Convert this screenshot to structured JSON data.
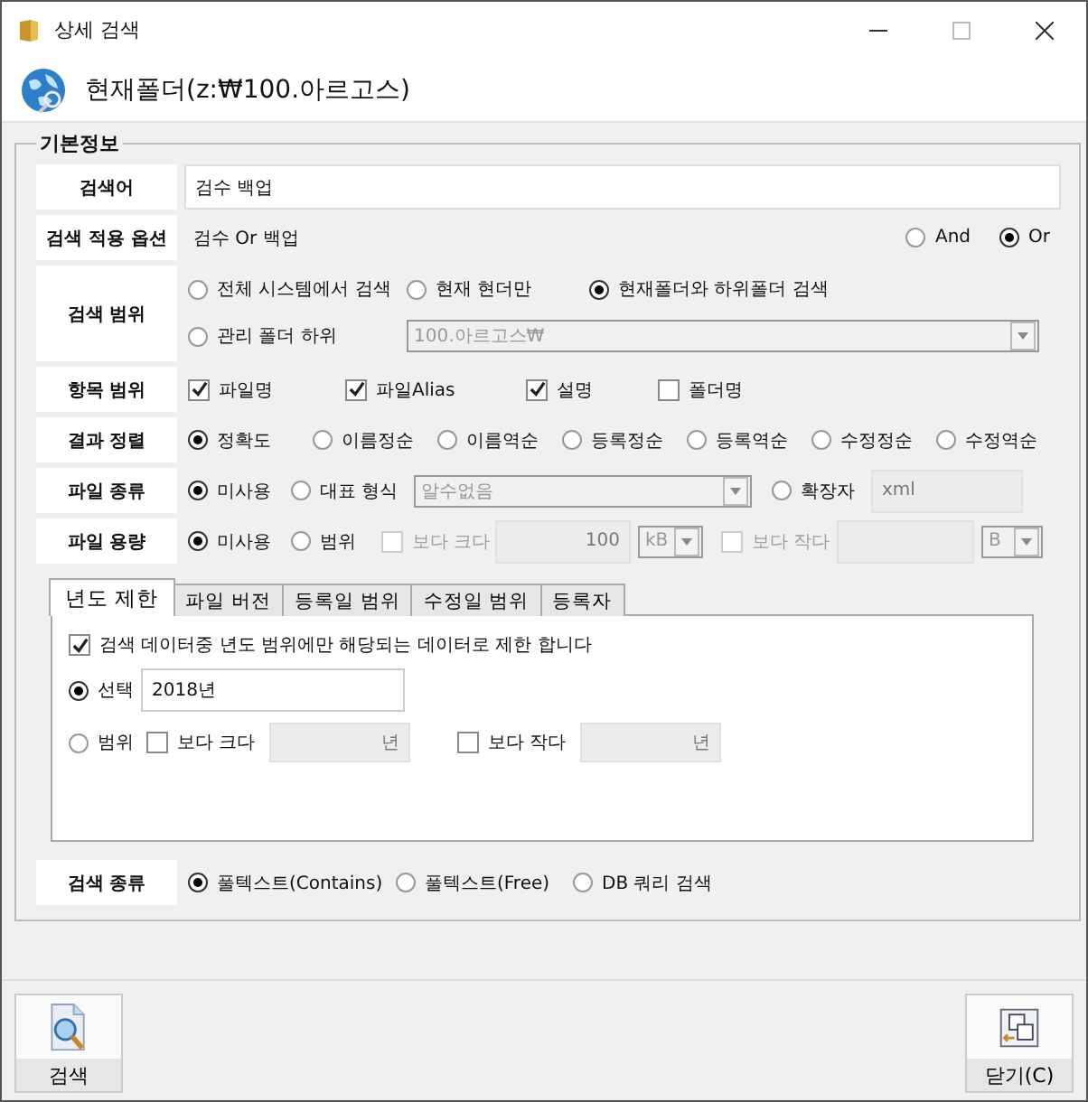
{
  "window": {
    "title": "상세 검색"
  },
  "header": {
    "title": "현재폴더(z:₩100.아르고스)"
  },
  "group": {
    "legend": "기본정보"
  },
  "rows": [
    {
      "kind": "input",
      "label": "검색어",
      "controls": [
        {
          "kind": "field",
          "value": "검수 백업"
        }
      ]
    },
    {
      "kind": "option",
      "label": "검색 적용 옵션",
      "controls": [
        {
          "kind": "text",
          "value": "검수 Or 백업"
        },
        {
          "kind": "radio",
          "label": "And",
          "selected": false
        },
        {
          "kind": "radio",
          "label": "Or",
          "selected": true
        }
      ]
    },
    {
      "kind": "scope",
      "label": "검색 범위",
      "controls": [
        {
          "kind": "radio",
          "label": "전체 시스템에서 검색",
          "selected": false
        },
        {
          "kind": "radio",
          "label": "현재 현더만",
          "selected": false
        },
        {
          "kind": "radio",
          "label": "현재폴더와 하위폴더 검색",
          "selected": true
        },
        {
          "kind": "radio",
          "label": "관리 폴더 하위",
          "selected": false
        },
        {
          "kind": "combo",
          "value": "100.아르고스₩",
          "disabled": true
        }
      ]
    },
    {
      "kind": "checks",
      "label": "항목 범위",
      "controls": [
        {
          "kind": "checkbox",
          "label": "파일명",
          "checked": true
        },
        {
          "kind": "checkbox",
          "label": "파일Alias",
          "checked": true
        },
        {
          "kind": "checkbox",
          "label": "설명",
          "checked": true
        },
        {
          "kind": "checkbox",
          "label": "폴더명",
          "checked": false
        }
      ]
    },
    {
      "kind": "sort",
      "label": "결과 정렬",
      "controls": [
        {
          "kind": "radio",
          "label": "정확도",
          "selected": true
        },
        {
          "kind": "radio",
          "label": "이름정순",
          "selected": false
        },
        {
          "kind": "radio",
          "label": "이름역순",
          "selected": false
        },
        {
          "kind": "radio",
          "label": "등록정순",
          "selected": false
        },
        {
          "kind": "radio",
          "label": "등록역순",
          "selected": false
        },
        {
          "kind": "radio",
          "label": "수정정순",
          "selected": false
        },
        {
          "kind": "radio",
          "label": "수정역순",
          "selected": false
        }
      ]
    },
    {
      "kind": "filetype",
      "label": "파일 종류",
      "controls": [
        {
          "kind": "radio",
          "label": "미사용",
          "selected": true
        },
        {
          "kind": "radio",
          "label": "대표 형식",
          "selected": false
        },
        {
          "kind": "combo",
          "value": "알수없음",
          "disabled": true
        },
        {
          "kind": "radio",
          "label": "확장자",
          "selected": false
        },
        {
          "kind": "field",
          "value": "xml",
          "disabled": true
        }
      ]
    },
    {
      "kind": "filesize",
      "label": "파일 용량",
      "controls": [
        {
          "kind": "radio",
          "label": "미사용",
          "selected": true
        },
        {
          "kind": "radio",
          "label": "범위",
          "selected": false
        },
        {
          "kind": "checkbox",
          "label": "보다 크다",
          "checked": false,
          "disabled": true
        },
        {
          "kind": "field",
          "value": "100",
          "disabled": true
        },
        {
          "kind": "combo",
          "value": "kB",
          "disabled": true
        },
        {
          "kind": "checkbox",
          "label": "보다 작다",
          "checked": false,
          "disabled": true
        },
        {
          "kind": "field",
          "disabled": true
        },
        {
          "kind": "combo",
          "value": "B",
          "disabled": true
        }
      ]
    }
  ],
  "tabs": [
    {
      "label": "년도 제한",
      "selected": true
    },
    {
      "label": "파일 버전",
      "selected": false
    },
    {
      "label": "등록일 범위",
      "selected": false
    },
    {
      "label": "수정일 범위",
      "selected": false
    },
    {
      "label": "등록자",
      "selected": false
    }
  ],
  "tab_panel": {
    "limit": {
      "kind": "checkbox",
      "label": "검색 데이터중 년도 범위에만 해당되는 데이터로 제한 합니다",
      "checked": true
    },
    "lines": [
      [
        {
          "kind": "radio",
          "label": "선택",
          "selected": true
        },
        {
          "kind": "field",
          "value": "2018년"
        }
      ],
      [
        {
          "kind": "radio",
          "label": "범위",
          "selected": false
        },
        {
          "kind": "checkbox",
          "label": "보다 크다",
          "checked": false
        },
        {
          "kind": "field",
          "value": "년",
          "disabled": true
        },
        {
          "kind": "checkbox",
          "label": "보다 작다",
          "checked": false
        },
        {
          "kind": "field",
          "value": "년",
          "disabled": true
        }
      ]
    ]
  },
  "search_type": {
    "label": "검색 종류",
    "controls": [
      {
        "kind": "radio",
        "label": "풀텍스트(Contains)",
        "selected": true
      },
      {
        "kind": "radio",
        "label": "풀텍스트(Free)",
        "selected": false
      },
      {
        "kind": "radio",
        "label": "DB 쿼리 검색",
        "selected": false
      }
    ]
  },
  "buttons": [
    {
      "kind": "search",
      "label": "검색"
    },
    {
      "kind": "close",
      "label": "닫기(C)"
    }
  ]
}
